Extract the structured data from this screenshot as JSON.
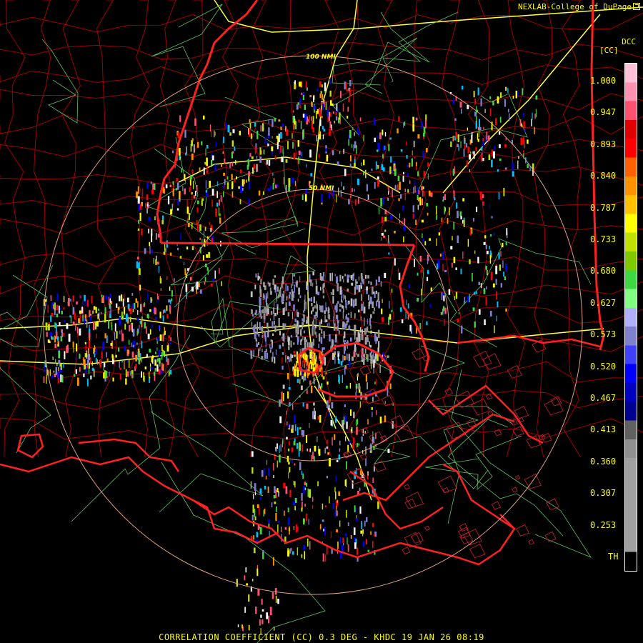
{
  "credit": "NEXLAB-College of DuPage",
  "credit_icon": "external-link-icon",
  "legend": {
    "product": "DCC",
    "unit": "[CC]",
    "ticks": [
      "1.000",
      "0.947",
      "0.893",
      "0.840",
      "0.787",
      "0.733",
      "0.680",
      "0.627",
      "0.573",
      "0.520",
      "0.467",
      "0.413",
      "0.360",
      "0.307",
      "0.253",
      "TH"
    ],
    "colors": [
      "#ffc0d8",
      "#ff90b0",
      "#ff5070",
      "#e00000",
      "#ff0000",
      "#ff6000",
      "#ff9000",
      "#ffc000",
      "#ffff00",
      "#c0e000",
      "#80c800",
      "#40d840",
      "#80ff80",
      "#b0b0ff",
      "#8080d0",
      "#4040ff",
      "#0000ff",
      "#0000c0",
      "#000090",
      "#606060",
      "#909090",
      "#a0a0a0",
      "#a0a0a0",
      "#a0a0a0",
      "#a0a0a0",
      "#a0a0a0",
      "#000000"
    ]
  },
  "rings": [
    {
      "label": "100 NMI"
    },
    {
      "label": "50 NMI"
    }
  ],
  "colors": {
    "background": "#000000",
    "county_lines": "#a00000",
    "state_lines": "#ff2020",
    "highways": "#ffff40",
    "roads": "#60c060",
    "rings": "#e0a080"
  },
  "caption": "CORRELATION COEFFICIENT (CC) 0.3 DEG - KHDC 19 JAN 26 08:19"
}
